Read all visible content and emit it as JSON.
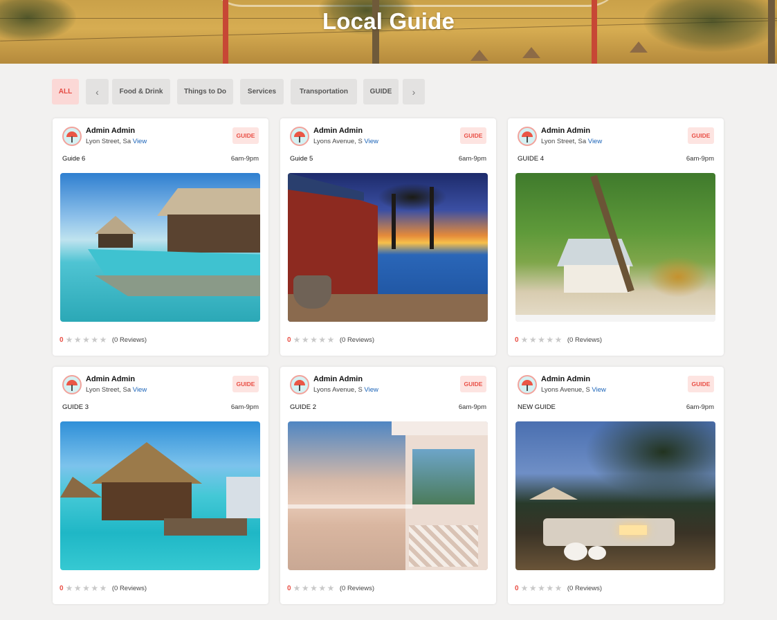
{
  "page": {
    "title": "Local Guide"
  },
  "filters": {
    "all": "ALL",
    "prev": "‹",
    "next": "›",
    "items": [
      "Food & Drink",
      "Things to Do",
      "Services",
      "Transportation",
      "GUIDE"
    ]
  },
  "colors": {
    "accent": "#e94f45",
    "accent_bg": "#fde4e1",
    "link": "#1a63b8",
    "star_empty": "#c9c9c9"
  },
  "cards": [
    {
      "author": "Admin Admin",
      "address": "Lyon Street, Sa",
      "view": "View",
      "badge": "GUIDE",
      "name": "Guide 6",
      "hours": "6am-9pm",
      "rating": "0",
      "stars": "★★★★★",
      "reviews": "(0 Reviews)",
      "image": "overwater-villa-pool"
    },
    {
      "author": "Admin Admin",
      "address": "Lyons Avenue, S",
      "view": "View",
      "badge": "GUIDE",
      "name": "Guide 5",
      "hours": "6am-9pm",
      "rating": "0",
      "stars": "★★★★★",
      "reviews": "(0 Reviews)",
      "image": "sunset-infinity-pool"
    },
    {
      "author": "Admin Admin",
      "address": "Lyon Street, Sa",
      "view": "View",
      "badge": "GUIDE",
      "name": "GUIDE 4",
      "hours": "6am-9pm",
      "rating": "0",
      "stars": "★★★★★",
      "reviews": "(0 Reviews)",
      "image": "palm-beach-cottage"
    },
    {
      "author": "Admin Admin",
      "address": "Lyon Street, Sa",
      "view": "View",
      "badge": "GUIDE",
      "name": "GUIDE 3",
      "hours": "6am-9pm",
      "rating": "0",
      "stars": "★★★★★",
      "reviews": "(0 Reviews)",
      "image": "thatched-water-bungalow"
    },
    {
      "author": "Admin Admin",
      "address": "Lyons Avenue, S",
      "view": "View",
      "badge": "GUIDE",
      "name": "GUIDE 2",
      "hours": "6am-9pm",
      "rating": "0",
      "stars": "★★★★★",
      "reviews": "(0 Reviews)",
      "image": "beach-veranda"
    },
    {
      "author": "Admin Admin",
      "address": "Lyons Avenue, S",
      "view": "View",
      "badge": "GUIDE",
      "name": "NEW GUIDE",
      "hours": "6am-9pm",
      "rating": "0",
      "stars": "★★★★★",
      "reviews": "(0 Reviews)",
      "image": "evening-lounge-terrace"
    }
  ]
}
